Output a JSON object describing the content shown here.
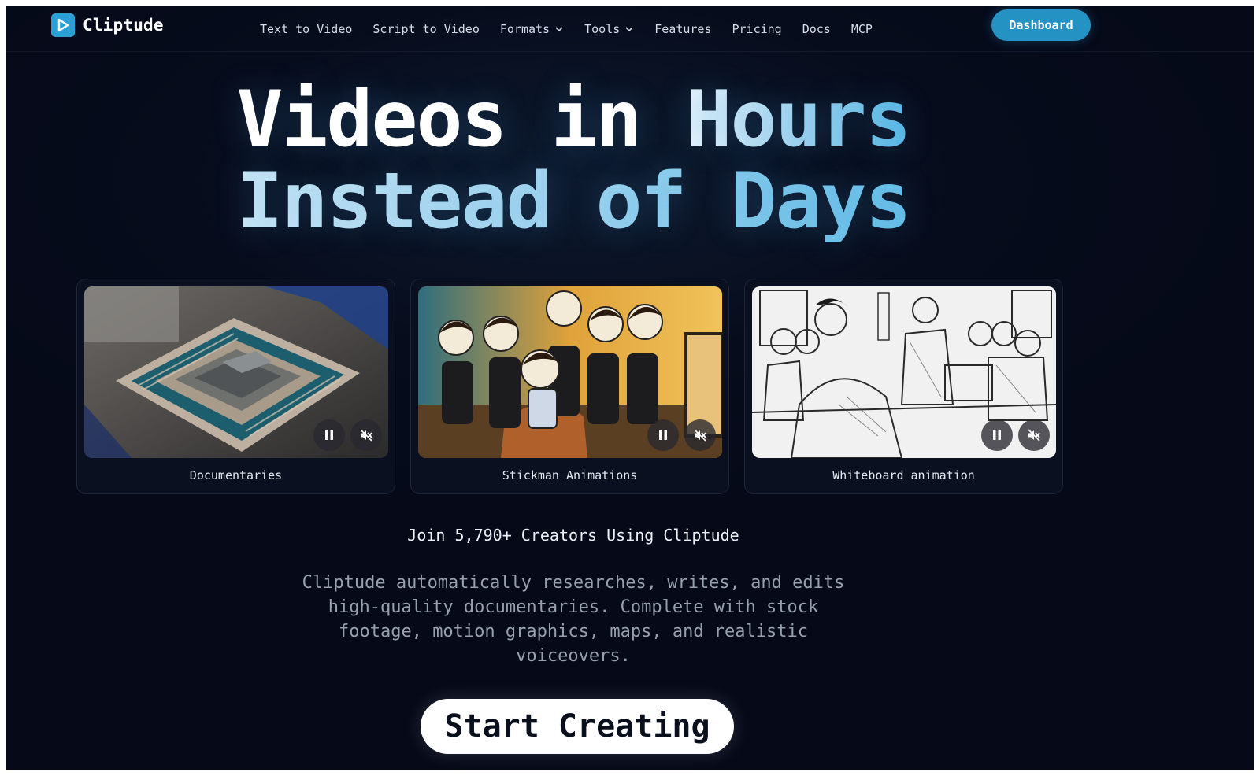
{
  "brand": {
    "name": "Cliptude",
    "accent": "#2aa0d6"
  },
  "nav": {
    "links": [
      {
        "label": "Text to Video",
        "dropdown": false
      },
      {
        "label": "Script to Video",
        "dropdown": false
      },
      {
        "label": "Formats",
        "dropdown": true
      },
      {
        "label": "Tools",
        "dropdown": true
      },
      {
        "label": "Features",
        "dropdown": false
      },
      {
        "label": "Pricing",
        "dropdown": false
      },
      {
        "label": "Docs",
        "dropdown": false
      },
      {
        "label": "MCP",
        "dropdown": false
      }
    ],
    "cta_label": "Dashboard"
  },
  "hero": {
    "line1": {
      "part1": "Videos in ",
      "part2": "Hours"
    },
    "line2": {
      "part1": "Instead of ",
      "part2": "Days"
    }
  },
  "cards": [
    {
      "label": "Documentaries",
      "icon": "cpu-chip-image"
    },
    {
      "label": "Stickman Animations",
      "icon": "stickman-office-image"
    },
    {
      "label": "Whiteboard animation",
      "icon": "whiteboard-sketch-image"
    }
  ],
  "join_text": "Join 5,790+ Creators Using Cliptude",
  "description": "Cliptude automatically researches, writes, and edits high-quality documentaries. Complete with stock footage, motion graphics, maps, and realistic voiceovers.",
  "cta_label": "Start Creating"
}
